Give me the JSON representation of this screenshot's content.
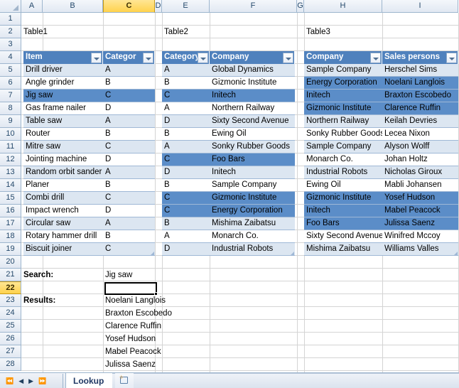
{
  "app": {
    "sheet_tab": "Lookup",
    "nav_first": "first-sheet",
    "nav_prev": "prev-sheet",
    "nav_next": "next-sheet",
    "nav_last": "last-sheet",
    "new_sheet": "new-sheet",
    "active_cell": "C22",
    "active_column": "C",
    "active_row": "22"
  },
  "colors": {
    "table_header": "#4F81BD",
    "band": "#DCE6F1",
    "highlight": "#5B8DC8",
    "active_header": "#FFD24D"
  },
  "columns": [
    "A",
    "B",
    "C",
    "D",
    "E",
    "F",
    "G",
    "H",
    "I"
  ],
  "rows": [
    "1",
    "2",
    "3",
    "4",
    "5",
    "6",
    "7",
    "8",
    "9",
    "10",
    "11",
    "12",
    "13",
    "14",
    "15",
    "16",
    "17",
    "18",
    "19",
    "20",
    "21",
    "22",
    "23",
    "24",
    "25",
    "26",
    "27",
    "28"
  ],
  "titles": {
    "table1": "Table1",
    "table2": "Table2",
    "table3": "Table3"
  },
  "table1": {
    "headers": [
      "Item",
      "Categor"
    ],
    "rows": [
      {
        "item": "Drill driver",
        "category": "A",
        "highlight": false
      },
      {
        "item": "Angle grinder",
        "category": "B",
        "highlight": false
      },
      {
        "item": "Jig saw",
        "category": "C",
        "highlight": true
      },
      {
        "item": "Gas frame nailer",
        "category": "D",
        "highlight": false
      },
      {
        "item": "Table saw",
        "category": "A",
        "highlight": false
      },
      {
        "item": "Router",
        "category": "B",
        "highlight": false
      },
      {
        "item": "Mitre saw",
        "category": "C",
        "highlight": false
      },
      {
        "item": "Jointing machine",
        "category": "D",
        "highlight": false
      },
      {
        "item": "Random orbit sander",
        "category": "A",
        "highlight": false
      },
      {
        "item": "Planer",
        "category": "B",
        "highlight": false
      },
      {
        "item": "Combi drill",
        "category": "C",
        "highlight": false
      },
      {
        "item": "Impact wrench",
        "category": "D",
        "highlight": false
      },
      {
        "item": "Circular saw",
        "category": "A",
        "highlight": false
      },
      {
        "item": "Rotary hammer drill",
        "category": "B",
        "highlight": false
      },
      {
        "item": "Biscuit joiner",
        "category": "C",
        "highlight": false
      }
    ]
  },
  "table2": {
    "headers": [
      "Category",
      "Company"
    ],
    "rows": [
      {
        "category": "A",
        "company": "Global Dynamics",
        "highlight": false
      },
      {
        "category": "B",
        "company": "Gizmonic Institute",
        "highlight": false
      },
      {
        "category": "C",
        "company": "Initech",
        "highlight": true
      },
      {
        "category": "A",
        "company": "Northern Railway",
        "highlight": false
      },
      {
        "category": "D",
        "company": "Sixty Second Avenue",
        "highlight": false
      },
      {
        "category": "B",
        "company": "Ewing Oil",
        "highlight": false
      },
      {
        "category": "A",
        "company": "Sonky Rubber Goods",
        "highlight": false
      },
      {
        "category": "C",
        "company": "Foo Bars",
        "highlight": true
      },
      {
        "category": "D",
        "company": "Initech",
        "highlight": false
      },
      {
        "category": "B",
        "company": "Sample Company",
        "highlight": false
      },
      {
        "category": "C",
        "company": "Gizmonic Institute",
        "highlight": true
      },
      {
        "category": "C",
        "company": "Energy Corporation",
        "highlight": true
      },
      {
        "category": "B",
        "company": "Mishima Zaibatsu",
        "highlight": false
      },
      {
        "category": "A",
        "company": "Monarch Co.",
        "highlight": false
      },
      {
        "category": "D",
        "company": "Industrial Robots",
        "highlight": false
      }
    ]
  },
  "table3": {
    "headers": [
      "Company",
      "Sales persons"
    ],
    "rows": [
      {
        "company": "Sample Company",
        "person": "Herschel Sims",
        "highlight": false
      },
      {
        "company": "Energy Corporation",
        "person": "Noelani Langlois",
        "highlight": true
      },
      {
        "company": "Initech",
        "person": "Braxton Escobedo",
        "highlight": true
      },
      {
        "company": "Gizmonic Institute",
        "person": "Clarence Ruffin",
        "highlight": true
      },
      {
        "company": "Northern Railway",
        "person": "Keilah Devries",
        "highlight": false
      },
      {
        "company": "Sonky Rubber Goods",
        "person": "Lecea Nixon",
        "highlight": false
      },
      {
        "company": "Sample Company",
        "person": "Alyson Wolff",
        "highlight": false
      },
      {
        "company": "Monarch Co.",
        "person": "Johan Holtz",
        "highlight": false
      },
      {
        "company": "Industrial Robots",
        "person": "Nicholas Giroux",
        "highlight": false
      },
      {
        "company": "Ewing Oil",
        "person": "Mabli Johansen",
        "highlight": false
      },
      {
        "company": "Gizmonic Institute",
        "person": "Yosef Hudson",
        "highlight": true
      },
      {
        "company": "Initech",
        "person": "Mabel Peacock",
        "highlight": true
      },
      {
        "company": "Foo Bars",
        "person": "Julissa Saenz",
        "highlight": true
      },
      {
        "company": "Sixty Second Avenue",
        "person": "Winifred Mccoy",
        "highlight": false
      },
      {
        "company": "Mishima Zaibatsu",
        "person": "Williams Valles",
        "highlight": false
      }
    ]
  },
  "lookup": {
    "search_label": "Search:",
    "search_value": "Jig saw",
    "results_label": "Results:",
    "results": [
      "Noelani Langlois",
      "Braxton Escobedo",
      "Clarence Ruffin",
      "Yosef Hudson",
      "Mabel Peacock",
      "Julissa Saenz"
    ]
  }
}
